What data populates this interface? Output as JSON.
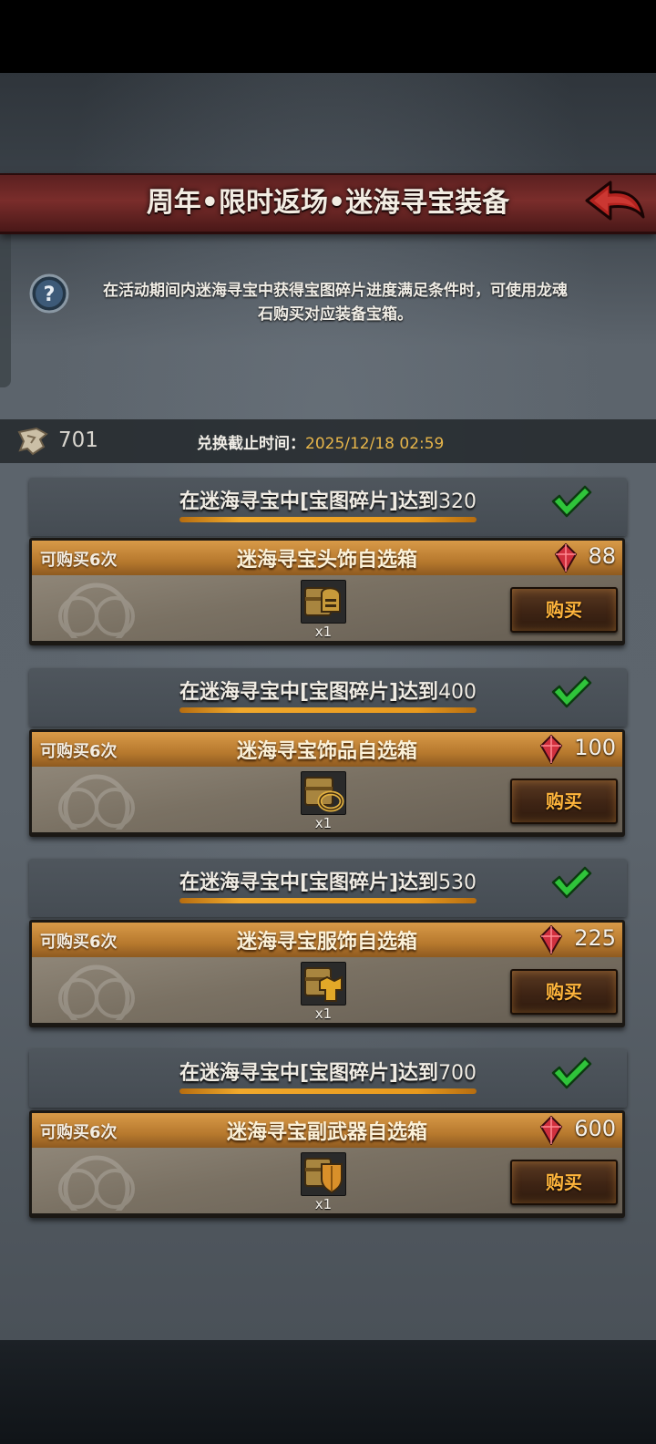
{
  "header": {
    "title": "周年•限时返场•迷海寻宝装备"
  },
  "description": {
    "line1": "在活动期间内迷海寻宝中获得宝图碎片进度满足条件时，可使用龙魂",
    "line2": "石购买对应装备宝箱。"
  },
  "info": {
    "map_fragments": "701",
    "deadline_label": "兑换截止时间：",
    "deadline_value": "2025/12/18 02:59"
  },
  "tiers": [
    {
      "condition_prefix": "在迷海寻宝中[宝图碎片]达到",
      "condition_value": "320",
      "limit": "可购买6次",
      "item_name": "迷海寻宝头饰自选箱",
      "price": "88",
      "quantity": "x1",
      "buy_label": "购买",
      "item_icon": "helmet-chest-icon"
    },
    {
      "condition_prefix": "在迷海寻宝中[宝图碎片]达到",
      "condition_value": "400",
      "limit": "可购买6次",
      "item_name": "迷海寻宝饰品自选箱",
      "price": "100",
      "quantity": "x1",
      "buy_label": "购买",
      "item_icon": "ring-chest-icon"
    },
    {
      "condition_prefix": "在迷海寻宝中[宝图碎片]达到",
      "condition_value": "530",
      "limit": "可购买6次",
      "item_name": "迷海寻宝服饰自选箱",
      "price": "225",
      "quantity": "x1",
      "buy_label": "购买",
      "item_icon": "armor-chest-icon"
    },
    {
      "condition_prefix": "在迷海寻宝中[宝图碎片]达到",
      "condition_value": "700",
      "limit": "可购买6次",
      "item_name": "迷海寻宝副武器自选箱",
      "price": "600",
      "quantity": "x1",
      "buy_label": "购买",
      "item_icon": "shield-chest-icon"
    }
  ],
  "colors": {
    "title_banner": "#7a2d2b",
    "card_header": "#d89a48",
    "buy_text": "#ffb53c",
    "deadline_value": "#e6b54a",
    "check": "#2fc43a",
    "gem": "#d0303e"
  }
}
